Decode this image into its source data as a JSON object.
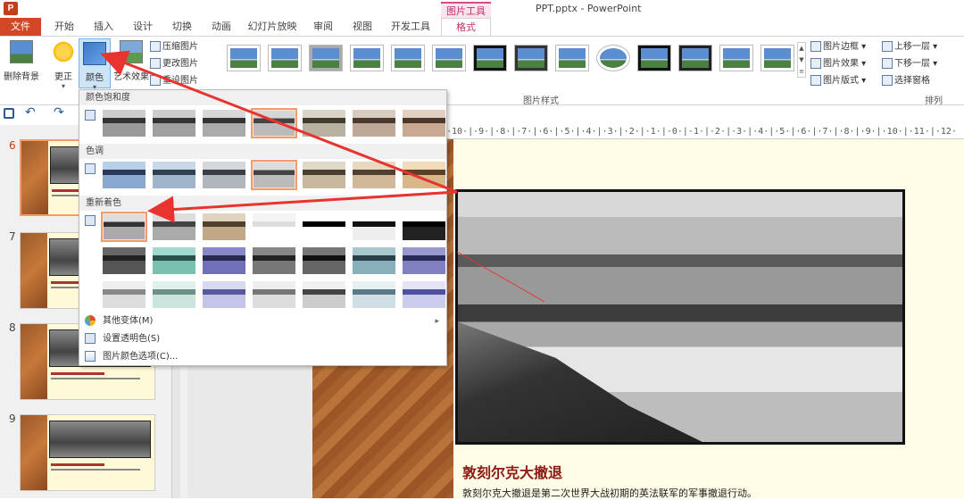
{
  "app": {
    "logo_letter": "P",
    "context_group": "图片工具",
    "window_title": "PPT.pptx - PowerPoint"
  },
  "tabs": [
    "文件",
    "开始",
    "插入",
    "设计",
    "切换",
    "动画",
    "幻灯片放映",
    "审阅",
    "视图",
    "开发工具",
    "格式"
  ],
  "ribbon": {
    "remove_bg": "删除背景",
    "corrections": "更正",
    "color": "颜色",
    "artistic": "艺术效果",
    "compress": "压缩图片",
    "change": "更改图片",
    "reset": "重设图片",
    "styles_group": "图片样式",
    "border": "图片边框",
    "effects": "图片效果",
    "layout": "图片版式",
    "bring_forward": "上移一层",
    "send_backward": "下移一层",
    "selection_pane": "选择窗格",
    "arrange_group": "排列"
  },
  "ruler_text": "·10·|·9·|·8·|·7·|·6·|·5·|·4·|·3·|·2·|·1·|·0·|·1·|·2·|·3·|·4·|·5·|·6·|·7·|·8·|·9·|·10·|·11·|·12·",
  "thumbnails": [
    {
      "num": "6"
    },
    {
      "num": "7"
    },
    {
      "num": "8"
    },
    {
      "num": "9"
    }
  ],
  "dropdown": {
    "sat_header": "颜色饱和度",
    "tone_header": "色调",
    "recolor_header": "重新着色",
    "more_variations": "其他变体(M)",
    "set_transparent": "设置透明色(S)",
    "color_options": "图片颜色选项(C)..."
  },
  "slide": {
    "heading": "敦刻尔克大撤退",
    "body": "敦刻尔克大撤退是第二次世界大战初期的英法联军的军事撤退行动。"
  },
  "colors": {
    "file_tab": "#d24726",
    "format_tab": "#c0306b",
    "heading": "#8c1a12",
    "arrow": "#e8332f",
    "selection": "#f29b6c"
  }
}
